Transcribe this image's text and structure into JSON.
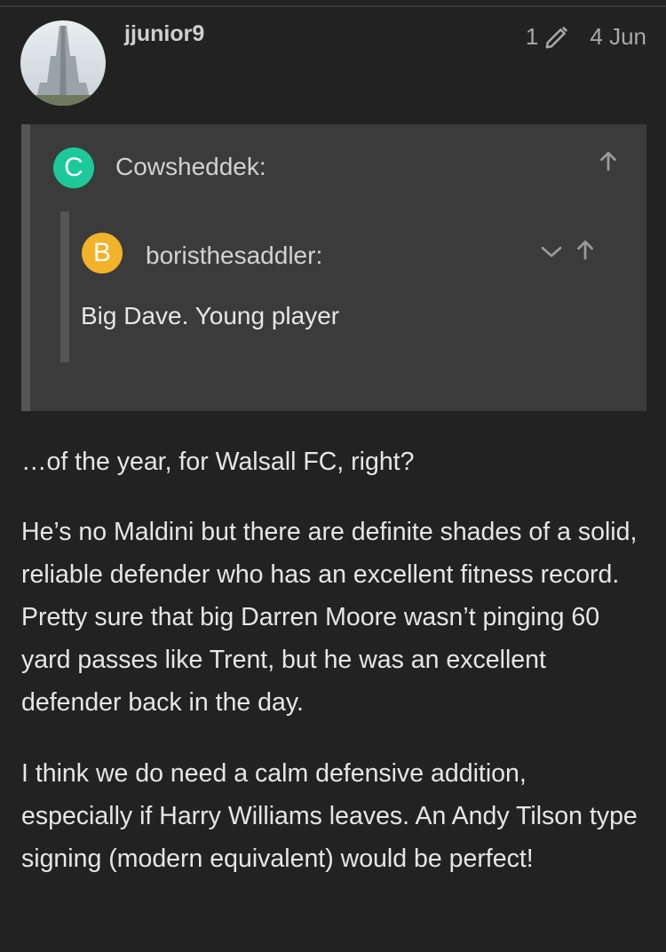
{
  "post": {
    "username": "jjunior9",
    "edit_count": "1",
    "date": "4 Jun",
    "avatar_icon": "building-photo-avatar"
  },
  "quote_outer": {
    "initial": "C",
    "initial_color": "#1dc99a",
    "author": "Cowsheddek:",
    "expand_icon": "arrow-up-icon"
  },
  "quote_inner": {
    "initial": "B",
    "initial_color": "#f2b229",
    "author": "boristhesaddler:",
    "text": "Big Dave. Young player",
    "icons": [
      "chevron-down-icon",
      "arrow-up-icon"
    ]
  },
  "body": {
    "paragraphs": [
      "…of the year, for Walsall FC, right?",
      "He’s no Maldini but there are definite shades of a solid, reliable defender who has an excellent fitness record. Pretty sure that big Darren Moore wasn’t pinging 60 yard passes like Trent, but he was an excellent defender back in the day.",
      "I think we do need a calm defensive addition, especially if Harry Williams leaves. An Andy Tilson type signing (modern equivalent) would be perfect!"
    ]
  }
}
